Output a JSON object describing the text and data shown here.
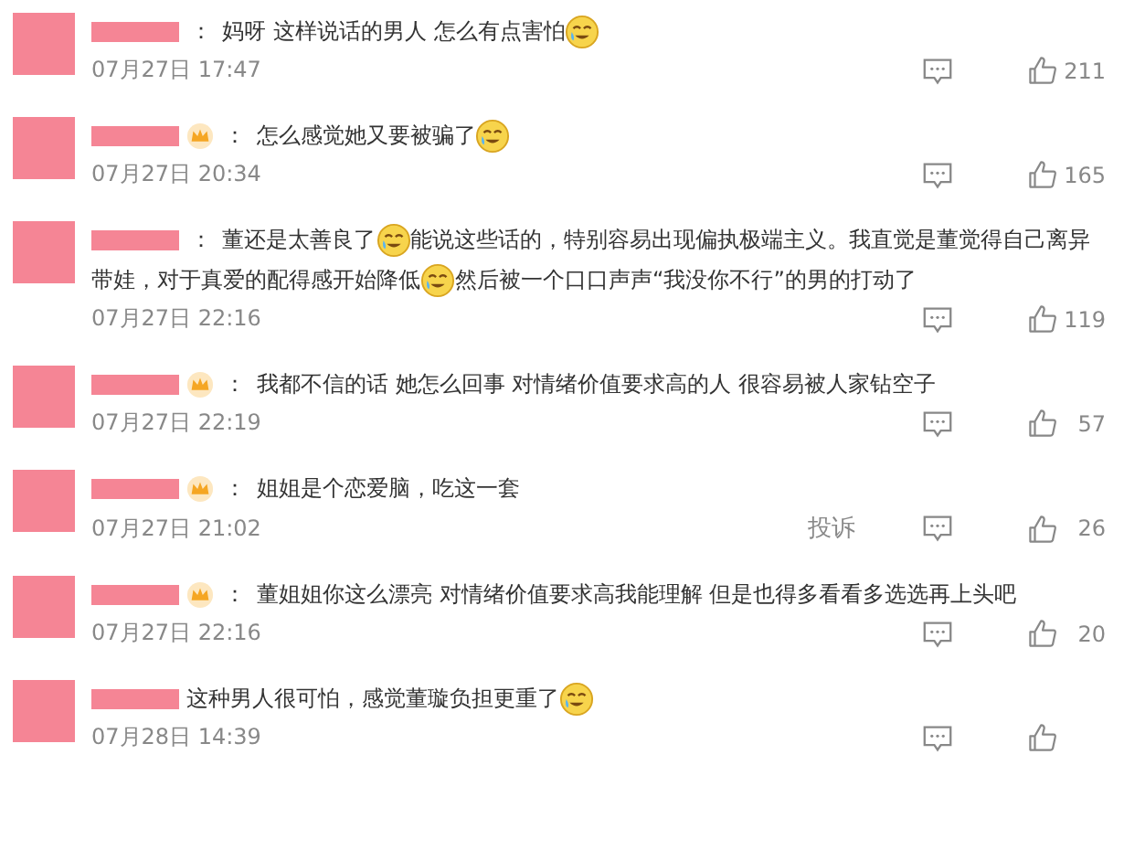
{
  "comments": [
    {
      "badge": false,
      "separator": "：",
      "parts": [
        {
          "kind": "text",
          "text": "妈呀 这样说话的男人 怎么有点害怕"
        },
        {
          "kind": "emoji"
        }
      ],
      "time": "07月27日 17:47",
      "likes": "211"
    },
    {
      "badge": true,
      "separator": "：",
      "parts": [
        {
          "kind": "text",
          "text": "怎么感觉她又要被骗了"
        },
        {
          "kind": "emoji"
        }
      ],
      "time": "07月27日 20:34",
      "likes": "165"
    },
    {
      "badge": false,
      "separator": "：",
      "parts": [
        {
          "kind": "text",
          "text": "董还是太善良了"
        },
        {
          "kind": "emoji"
        },
        {
          "kind": "text",
          "text": "能说这些话的，特别容易出现偏执极端主义。我直觉是董觉得自己离异"
        },
        {
          "kind": "text",
          "text": "带娃，对于真爱的配得感开始降低"
        },
        {
          "kind": "emoji"
        },
        {
          "kind": "text",
          "text": "然后被一个口口声声“我没你不行”的男的打动了"
        }
      ],
      "time": "07月27日 22:16",
      "likes": "119"
    },
    {
      "badge": true,
      "separator": "：",
      "parts": [
        {
          "kind": "text",
          "text": "我都不信的话 她怎么回事 对情绪价值要求高的人 很容易被人家钻空子"
        }
      ],
      "time": "07月27日 22:19",
      "likes": "57"
    },
    {
      "badge": true,
      "separator": "：",
      "parts": [
        {
          "kind": "text",
          "text": "姐姐是个恋爱脑，吃这一套"
        }
      ],
      "time": "07月27日 21:02",
      "report": "投诉",
      "likes": "26"
    },
    {
      "badge": true,
      "separator": "：",
      "parts": [
        {
          "kind": "text",
          "text": "董姐姐你这么漂亮 对情绪价值要求高我能理解 但是也得多看看多选选再上头吧"
        }
      ],
      "time": "07月27日 22:16",
      "likes": "20"
    },
    {
      "badge": false,
      "parts": [
        {
          "kind": "text",
          "text": "这种男人很可怕，感觉董璇负担更重了"
        },
        {
          "kind": "emoji"
        }
      ],
      "time": "07月28日 14:39"
    }
  ]
}
